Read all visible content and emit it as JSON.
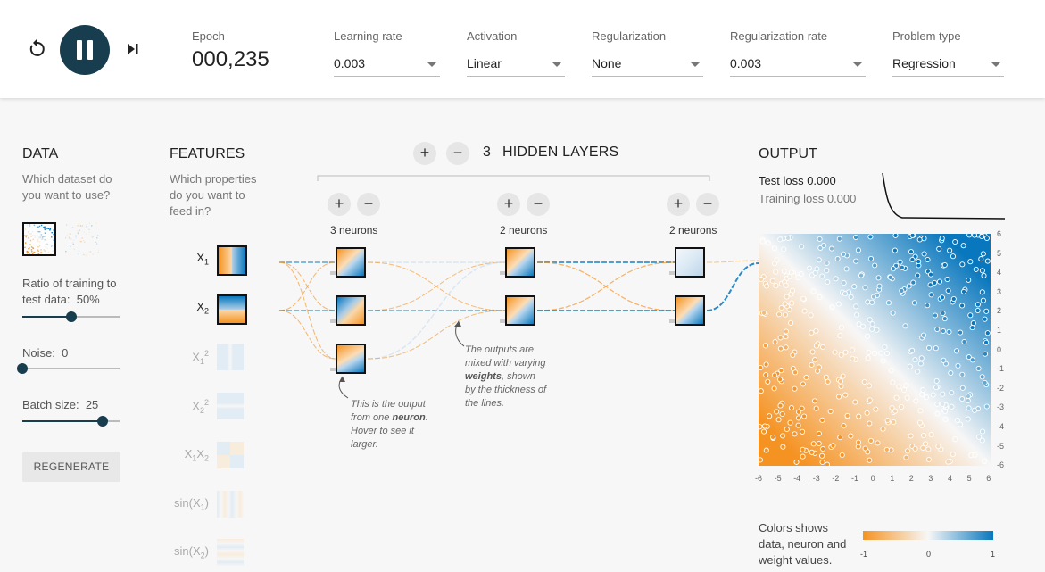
{
  "controls": {
    "reset_icon": "reset-icon",
    "play_icon": "pause-icon",
    "step_icon": "step-forward-icon",
    "play_color": "#183d4e"
  },
  "epoch": {
    "label": "Epoch",
    "value": "000,235"
  },
  "settings": {
    "learning_rate": {
      "label": "Learning rate",
      "value": "0.003"
    },
    "activation": {
      "label": "Activation",
      "value": "Linear"
    },
    "regularization": {
      "label": "Regularization",
      "value": "None"
    },
    "regularization_rate": {
      "label": "Regularization rate",
      "value": "0.003"
    },
    "problem_type": {
      "label": "Problem type",
      "value": "Regression"
    }
  },
  "data_panel": {
    "heading": "DATA",
    "question_line1": "Which dataset do",
    "question_line2": "you want to use?",
    "ratio_label_line1": "Ratio of training to",
    "ratio_label_line2": "test data:",
    "ratio_value": "50%",
    "ratio_fraction": 0.5,
    "noise_label": "Noise:",
    "noise_value": "0",
    "noise_fraction": 0,
    "batch_label": "Batch size:",
    "batch_value": "25",
    "batch_fraction": 0.83,
    "regenerate_label": "REGENERATE"
  },
  "features_panel": {
    "heading": "FEATURES",
    "question_line1": "Which properties",
    "question_line2": "do you want to",
    "question_line3": "feed in?",
    "features": [
      {
        "base": "X",
        "sub": "1",
        "sup": "",
        "active": true
      },
      {
        "base": "X",
        "sub": "2",
        "sup": "",
        "active": true
      },
      {
        "base": "X",
        "sub": "1",
        "sup": "2",
        "active": false
      },
      {
        "base": "X",
        "sub": "2",
        "sup": "2",
        "active": false
      },
      {
        "base": "X",
        "sub": "1",
        "sup": "",
        "base2": "X",
        "sub2": "2",
        "active": false
      },
      {
        "base": "sin(X",
        "sub": "1",
        "close": ")",
        "active": false
      },
      {
        "base": "sin(X",
        "sub": "2",
        "close": ")",
        "active": false
      }
    ]
  },
  "network": {
    "add_layer": "+",
    "remove_layer": "−",
    "hidden_layer_count": "3",
    "hidden_layers_label": "HIDDEN LAYERS",
    "layers": [
      {
        "neurons_label": "3 neurons",
        "add": "+",
        "remove": "−"
      },
      {
        "neurons_label": "2 neurons",
        "add": "+",
        "remove": "−"
      },
      {
        "neurons_label": "2 neurons",
        "add": "+",
        "remove": "−"
      }
    ],
    "annotation_neuron": {
      "line1": "This is the output",
      "line2_pre": "from one ",
      "line2_bold": "neuron",
      "line2_post": ".",
      "line3": "Hover to see it",
      "line4": "larger."
    },
    "annotation_weights": {
      "line1": "The outputs are",
      "line2": "mixed with varying",
      "line3_bold": "weights",
      "line3_post": ", shown",
      "line4": "by the thickness of",
      "line5": "the lines."
    }
  },
  "output": {
    "heading": "OUTPUT",
    "test_loss_label": "Test loss",
    "test_loss_value": "0.000",
    "training_loss_label": "Training loss",
    "training_loss_value": "0.000",
    "x_ticks": [
      "-6",
      "-5",
      "-4",
      "-3",
      "-2",
      "-1",
      "0",
      "1",
      "2",
      "3",
      "4",
      "5",
      "6"
    ],
    "y_ticks": [
      "6",
      "5",
      "4",
      "3",
      "2",
      "1",
      "0",
      "-1",
      "-2",
      "-3",
      "-4",
      "-5",
      "-6"
    ],
    "legend_line1": "Colors shows",
    "legend_line2": "data, neuron and",
    "legend_line3": "weight values.",
    "legend_ticks": [
      "-1",
      "0",
      "1"
    ],
    "color_negative": "#f59322",
    "color_positive": "#0877bd"
  }
}
